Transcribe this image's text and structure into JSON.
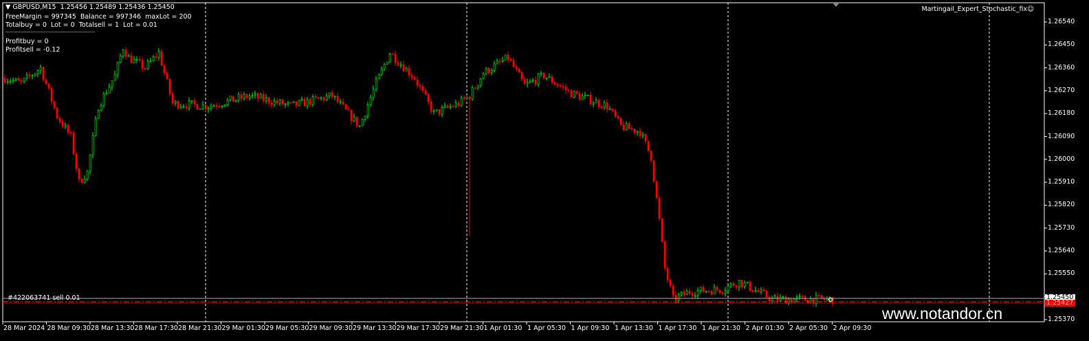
{
  "header": {
    "symbol_line": "GBPUSD,M15  1.25456 1.25489 1.25436 1.25450"
  },
  "stats": {
    "line1": "FreeMargin = 997345  Balance = 997346  maxLot = 200",
    "line2": "Totalbuy = 0  Lot = 0  Totalsell = 1  Lot = 0.01",
    "separator": "------------------------------------------------------------",
    "profitbuy": "Profitbuy = 0",
    "profitsell": "Profitsell = -0.12"
  },
  "expert": {
    "name": "Martingail_Expert_Stochastic_fix",
    "icon": "smiley-icon"
  },
  "order_label": "#422063741 sell 0.01",
  "current_price_label": "1.25450",
  "order_price_label": "1.25427",
  "watermark": "www.notandor.cn",
  "colors": {
    "bull": "#00ff00",
    "bear": "#ff0000",
    "order": "#ff0000",
    "grid": "#ffffff"
  },
  "chart_data": {
    "type": "candlestick",
    "symbol": "GBPUSD",
    "timeframe": "M15",
    "ylim": [
      1.2535,
      1.2663
    ],
    "y_ticks": [
      "1.26540",
      "1.26450",
      "1.26360",
      "1.26270",
      "1.26180",
      "1.26090",
      "1.26000",
      "1.25910",
      "1.25820",
      "1.25730",
      "1.25640",
      "1.25550",
      "1.25460",
      "1.25370"
    ],
    "x_ticks": [
      "28 Mar 2024",
      "28 Mar 09:30",
      "28 Mar 13:30",
      "28 Mar 17:30",
      "28 Mar 21:30",
      "29 Mar 01:30",
      "29 Mar 05:30",
      "29 Mar 09:30",
      "29 Mar 13:30",
      "29 Mar 17:30",
      "29 Mar 21:30",
      "1 Apr 01:30",
      "1 Apr 05:30",
      "1 Apr 09:30",
      "1 Apr 13:30",
      "1 Apr 17:30",
      "1 Apr 21:30",
      "2 Apr 01:30",
      "2 Apr 05:30",
      "2 Apr 09:30"
    ],
    "approx_close_path": [
      [
        0,
        1.2632
      ],
      [
        6,
        1.263
      ],
      [
        13,
        1.2636
      ],
      [
        19,
        1.2617
      ],
      [
        24,
        1.2609
      ],
      [
        27,
        1.2591
      ],
      [
        30,
        1.2595
      ],
      [
        34,
        1.2621
      ],
      [
        40,
        1.2633
      ],
      [
        43,
        1.2644
      ],
      [
        45,
        1.264
      ],
      [
        51,
        1.2636
      ],
      [
        56,
        1.2642
      ],
      [
        61,
        1.2622
      ],
      [
        74,
        1.2621
      ],
      [
        89,
        1.2625
      ],
      [
        104,
        1.2621
      ],
      [
        119,
        1.2625
      ],
      [
        129,
        1.2613
      ],
      [
        135,
        1.263
      ],
      [
        140,
        1.2642
      ],
      [
        149,
        1.2632
      ],
      [
        156,
        1.2618
      ],
      [
        165,
        1.2622
      ],
      [
        169,
        1.2625
      ],
      [
        174,
        1.2634
      ],
      [
        183,
        1.264
      ],
      [
        189,
        1.2629
      ],
      [
        196,
        1.2633
      ],
      [
        206,
        1.2626
      ],
      [
        219,
        1.2621
      ],
      [
        224,
        1.2613
      ],
      [
        231,
        1.2611
      ],
      [
        235,
        1.2601
      ],
      [
        238,
        1.2576
      ],
      [
        240,
        1.2557
      ],
      [
        243,
        1.2545
      ],
      [
        249,
        1.2548
      ],
      [
        261,
        1.2549
      ],
      [
        267,
        1.2552
      ],
      [
        279,
        1.2545
      ],
      [
        301,
        1.2545
      ]
    ],
    "spike_low": {
      "bar": 169,
      "price": 1.257
    },
    "order_price": 1.25427,
    "bid": 1.2545
  }
}
